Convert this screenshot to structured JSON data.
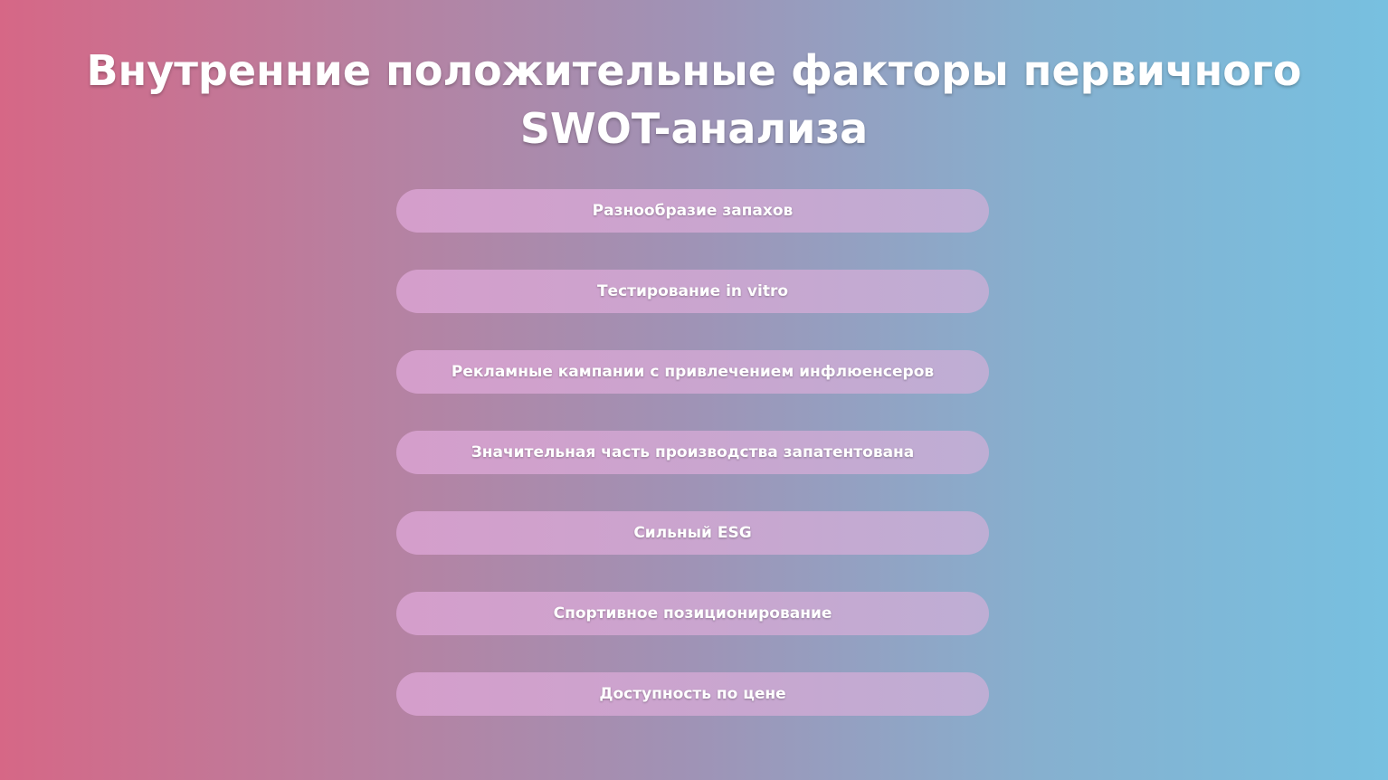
{
  "slide": {
    "title_line1": "Внутренние положительные факторы первичного",
    "title_line2": "SWOT-анализа",
    "factors": [
      "Разнообразие запахов",
      "Тестирование in vitro",
      "Рекламные кампании с привлечением инфлюенсеров",
      "Значительная часть производства запатентована",
      "Сильный ESG",
      "Спортивное позиционирование",
      "Доступность по цене"
    ]
  }
}
